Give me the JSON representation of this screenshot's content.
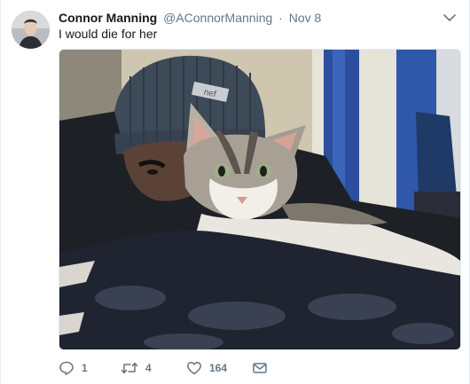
{
  "tweet": {
    "author": {
      "name": "Connor Manning",
      "handle": "@AConnorManning"
    },
    "separator": "·",
    "timestamp": "Nov 8",
    "text": "I would die for her",
    "media": {
      "beanie_label": "nef"
    },
    "actions": {
      "replies": "1",
      "retweets": "4",
      "likes": "164"
    }
  },
  "colors": {
    "text_primary": "#14171a",
    "text_secondary": "#657786",
    "border": "#e6ecf0"
  },
  "icons": {
    "menu": "chevron-down-icon",
    "reply": "reply-icon",
    "retweet": "retweet-icon",
    "like": "heart-icon",
    "dm": "envelope-icon"
  }
}
